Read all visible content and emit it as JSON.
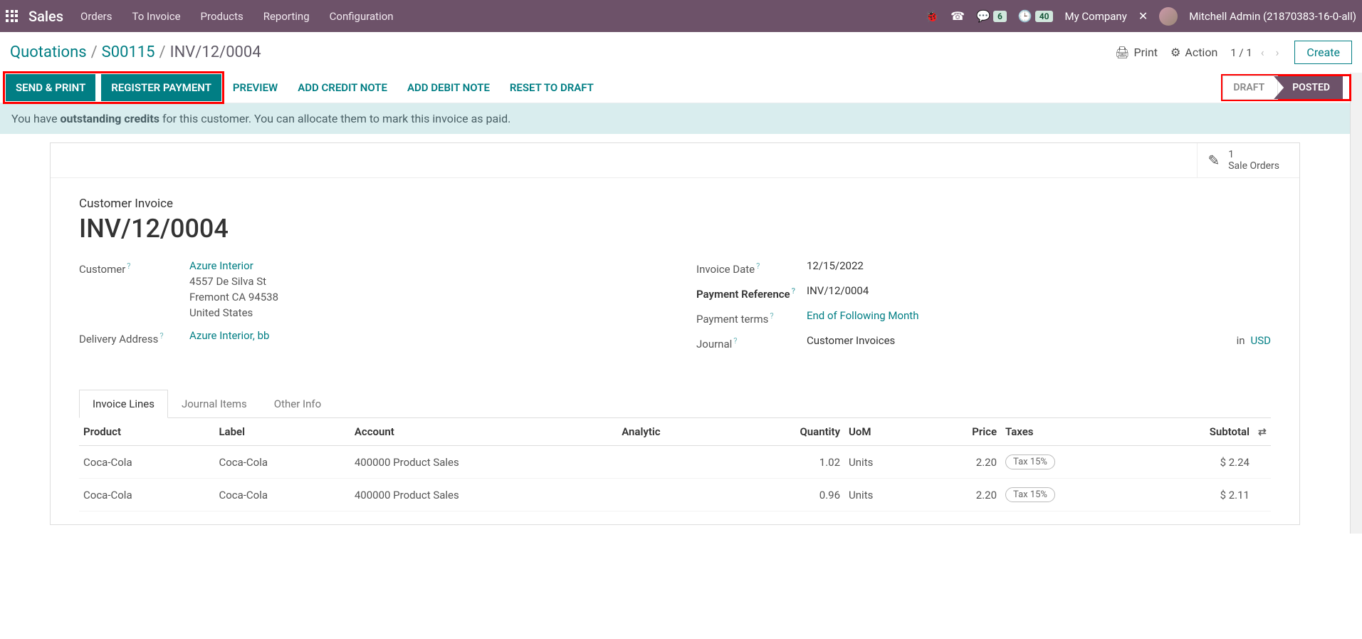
{
  "nav": {
    "brand": "Sales",
    "links": [
      "Orders",
      "To Invoice",
      "Products",
      "Reporting",
      "Configuration"
    ],
    "msg_badge": "6",
    "clock_badge": "40",
    "company": "My Company",
    "user": "Mitchell Admin (21870383-16-0-all)"
  },
  "breadcrumb": {
    "l1": "Quotations",
    "l2": "S00115",
    "current": "INV/12/0004",
    "print": "Print",
    "action": "Action",
    "pager": "1 / 1",
    "create": "Create"
  },
  "buttons": {
    "send_print": "SEND & PRINT",
    "register_payment": "REGISTER PAYMENT",
    "preview": "PREVIEW",
    "add_credit": "ADD CREDIT NOTE",
    "add_debit": "ADD DEBIT NOTE",
    "reset": "RESET TO DRAFT"
  },
  "status": {
    "draft": "DRAFT",
    "posted": "POSTED"
  },
  "alert": {
    "pre": "You have ",
    "bold": "outstanding credits",
    "post": " for this customer. You can allocate them to mark this invoice as paid."
  },
  "stat": {
    "count": "1",
    "label": "Sale Orders"
  },
  "heading": {
    "small": "Customer Invoice",
    "large": "INV/12/0004"
  },
  "left_fields": {
    "customer_label": "Customer",
    "customer_link": "Azure Interior",
    "addr1": "4557 De Silva St",
    "addr2": "Fremont CA 94538",
    "addr3": "United States",
    "delivery_label": "Delivery Address",
    "delivery_link": "Azure Interior, bb"
  },
  "right_fields": {
    "invoice_date_label": "Invoice Date",
    "invoice_date": "12/15/2022",
    "payment_ref_label": "Payment Reference",
    "payment_ref": "INV/12/0004",
    "payment_terms_label": "Payment terms",
    "payment_terms": "End of Following Month",
    "journal_label": "Journal",
    "journal": "Customer Invoices",
    "in": "in",
    "currency": "USD"
  },
  "tabs": {
    "t1": "Invoice Lines",
    "t2": "Journal Items",
    "t3": "Other Info"
  },
  "table": {
    "headers": {
      "product": "Product",
      "label": "Label",
      "account": "Account",
      "analytic": "Analytic",
      "quantity": "Quantity",
      "uom": "UoM",
      "price": "Price",
      "taxes": "Taxes",
      "subtotal": "Subtotal"
    },
    "rows": [
      {
        "product": "Coca-Cola",
        "label": "Coca-Cola",
        "account": "400000 Product Sales",
        "analytic": "",
        "qty": "1.02",
        "uom": "Units",
        "price": "2.20",
        "tax": "Tax 15%",
        "subtotal": "$ 2.24"
      },
      {
        "product": "Coca-Cola",
        "label": "Coca-Cola",
        "account": "400000 Product Sales",
        "analytic": "",
        "qty": "0.96",
        "uom": "Units",
        "price": "2.20",
        "tax": "Tax 15%",
        "subtotal": "$ 2.11"
      }
    ]
  }
}
